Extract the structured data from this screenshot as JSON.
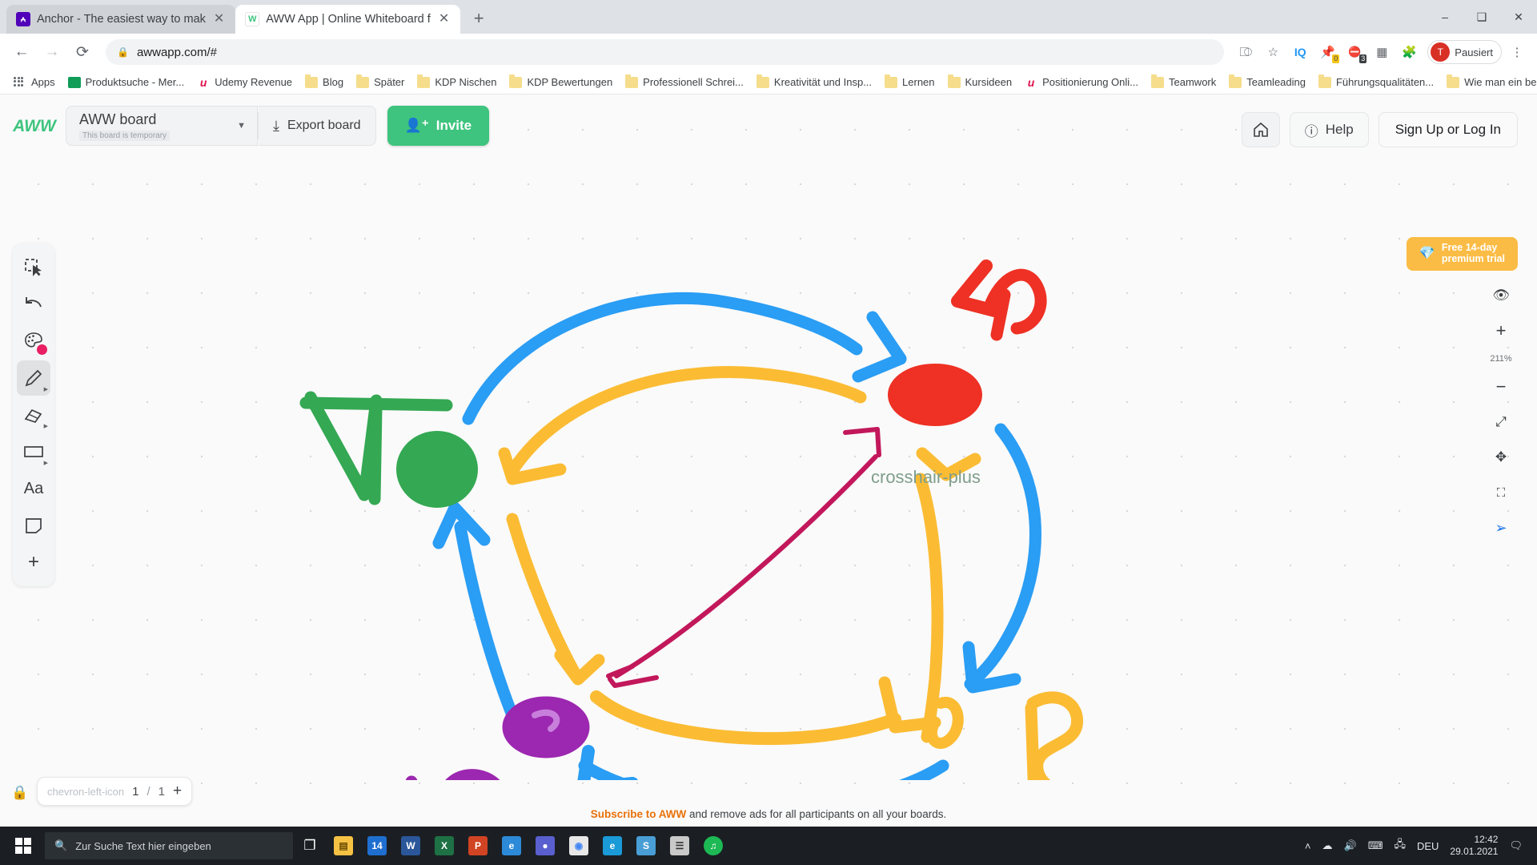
{
  "browser": {
    "tabs": [
      {
        "title": "Anchor - The easiest way to mak",
        "favicon": "anchor-icon",
        "active": false
      },
      {
        "title": "AWW App | Online Whiteboard f",
        "favicon": "aww-icon",
        "active": true
      }
    ],
    "new_tab_label": "+",
    "window_controls": {
      "minimize": "–",
      "maximize": "❑",
      "close": "✕"
    },
    "nav": {
      "back": "←",
      "forward": "→",
      "reload": "⟳"
    },
    "url": "awwapp.com/#",
    "lock_icon": "lock-icon",
    "omni_icons": [
      "translate-icon",
      "bookmark-star-icon",
      "iq-extension-icon",
      "pin-extension-icon",
      "adblock-extension-icon",
      "apps-grid-icon",
      "extensions-puzzle-icon"
    ],
    "adblock_badge": "3",
    "pin_badge": "0",
    "profile": {
      "initial": "T",
      "label": "Pausiert"
    },
    "menu_icon": "kebab-menu-icon",
    "bookmarks": [
      {
        "label": "Apps",
        "icon": "apps-grid-icon"
      },
      {
        "label": "Produktsuche - Mer...",
        "icon": "site-icon"
      },
      {
        "label": "Udemy Revenue",
        "icon": "udemy-icon"
      },
      {
        "label": "Blog",
        "icon": "folder-icon"
      },
      {
        "label": "Später",
        "icon": "folder-icon"
      },
      {
        "label": "KDP Nischen",
        "icon": "folder-icon"
      },
      {
        "label": "KDP Bewertungen",
        "icon": "folder-icon"
      },
      {
        "label": "Professionell Schrei...",
        "icon": "folder-icon"
      },
      {
        "label": "Kreativität und Insp...",
        "icon": "folder-icon"
      },
      {
        "label": "Lernen",
        "icon": "folder-icon"
      },
      {
        "label": "Kursideen",
        "icon": "folder-icon"
      },
      {
        "label": "Positionierung Onli...",
        "icon": "udemy-icon"
      },
      {
        "label": "Teamwork",
        "icon": "folder-icon"
      },
      {
        "label": "Teamleading",
        "icon": "folder-icon"
      },
      {
        "label": "Führungsqualitäten...",
        "icon": "folder-icon"
      },
      {
        "label": "Wie man ein besser...",
        "icon": "folder-icon"
      }
    ],
    "overflow_label": "»"
  },
  "app": {
    "logo_text": "AWW",
    "board": {
      "name": "AWW board",
      "temporary_badge": "This board is temporary",
      "dropdown_icon": "chevron-down-icon"
    },
    "export_label": "Export board",
    "export_icon": "download-icon",
    "invite_label": "Invite",
    "invite_icon": "person-add-icon",
    "home_icon": "home-icon",
    "help_label": "Help",
    "help_icon": "info-circle-icon",
    "signup_label": "Sign Up or Log In",
    "trial": {
      "line1": "Free 14-day",
      "line2": "premium trial",
      "icon": "diamond-icon"
    },
    "tools": [
      {
        "name": "select-tool",
        "icon": "select-marquee-icon",
        "active": false
      },
      {
        "name": "undo-tool",
        "icon": "undo-arrow-icon",
        "active": false
      },
      {
        "name": "color-tool",
        "icon": "palette-icon",
        "active": false,
        "color": "#e91e63"
      },
      {
        "name": "pen-tool",
        "icon": "pencil-icon",
        "active": true
      },
      {
        "name": "eraser-tool",
        "icon": "eraser-icon",
        "active": false
      },
      {
        "name": "shape-tool",
        "icon": "rectangle-icon",
        "active": false
      },
      {
        "name": "text-tool",
        "icon": "text-aa-icon",
        "label": "Aa",
        "active": false
      },
      {
        "name": "note-tool",
        "icon": "sticky-note-icon",
        "active": false
      },
      {
        "name": "add-tool",
        "icon": "plus-icon",
        "active": false
      }
    ],
    "zoom": {
      "eye_icon": "eye-icon",
      "plus": "+",
      "level": "211%",
      "minus": "−",
      "fit_icon": "expand-diagonal-icon",
      "pan_icon": "move-arrows-icon",
      "fullscreen_icon": "fullscreen-icon",
      "pointer_icon": "navigate-cursor-icon"
    },
    "pages": {
      "prev_icon": "chevron-left-icon",
      "current": "1",
      "separator": "/",
      "total": "1",
      "add_icon": "plus-icon"
    },
    "lock_icon": "lock-icon",
    "footer": {
      "link": "Subscribe to AWW",
      "text": " and remove ads for all participants on all your boards."
    },
    "cursor": "crosshair-plus"
  },
  "taskbar": {
    "start_icon": "windows-logo-icon",
    "search_placeholder": "Zur Suche Text hier eingeben",
    "search_icon": "search-icon",
    "taskview_icon": "task-view-icon",
    "apps": [
      {
        "name": "file-explorer",
        "label": "🗂",
        "color": "#f6c244"
      },
      {
        "name": "store",
        "label": "14",
        "color": "#1f6fd0"
      },
      {
        "name": "word",
        "label": "W",
        "color": "#2b579a"
      },
      {
        "name": "excel",
        "label": "X",
        "color": "#1e7145"
      },
      {
        "name": "powerpoint",
        "label": "P",
        "color": "#d04423"
      },
      {
        "name": "edge-old",
        "label": "e",
        "color": "#2d8ad8"
      },
      {
        "name": "media",
        "label": "●",
        "color": "#5a5fcf"
      },
      {
        "name": "chrome",
        "label": "◉",
        "color": "#e8e8e8"
      },
      {
        "name": "edge",
        "label": "e",
        "color": "#1a9ad7"
      },
      {
        "name": "skype",
        "label": "S",
        "color": "#4a9ed6"
      },
      {
        "name": "explorer2",
        "label": "☰",
        "color": "#c9c9c9"
      },
      {
        "name": "spotify",
        "label": "♫",
        "color": "#1db954"
      }
    ],
    "tray": {
      "chevron": "˄",
      "cloud_icon": "onedrive-icon",
      "speaker_icon": "volume-icon",
      "keyboard_icon": "keyboard-icon",
      "network_icon": "network-icon",
      "lang": "DEU"
    },
    "clock": {
      "time": "12:42",
      "date": "29.01.2021"
    },
    "notification_icon": "notification-icon"
  }
}
